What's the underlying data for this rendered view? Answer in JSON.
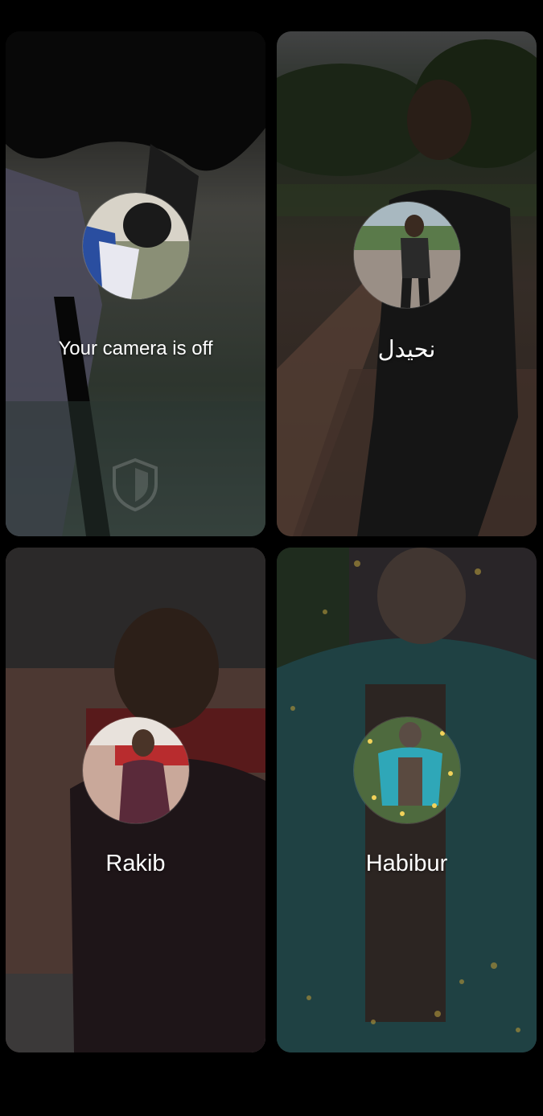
{
  "participants": [
    {
      "label": "Your camera is off",
      "avatar_icon": "person-photo-avatar",
      "is_self": true
    },
    {
      "label": "نحيدل",
      "avatar_icon": "person-photo-avatar"
    },
    {
      "label": "Rakib",
      "avatar_icon": "person-photo-avatar"
    },
    {
      "label": "Habibur",
      "avatar_icon": "person-photo-avatar"
    }
  ],
  "icons": {
    "security": "shield-icon"
  },
  "colors": {
    "background": "#000000",
    "text": "#ffffff"
  }
}
